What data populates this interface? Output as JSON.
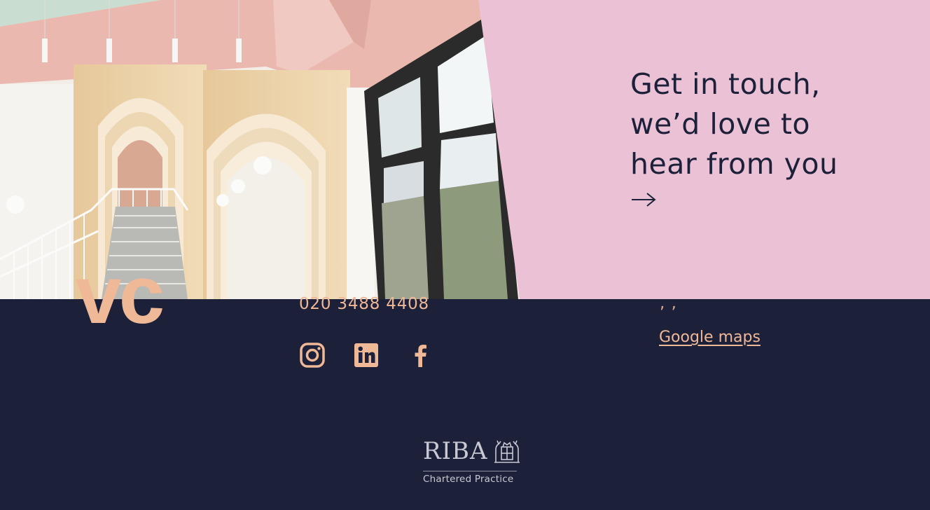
{
  "cta": {
    "lines": [
      "Get in touch,",
      "we’d love to",
      "hear from you"
    ],
    "arrow_icon": "arrow-right-icon"
  },
  "footer": {
    "big_letters": "vc",
    "phone": "020 3488 4408",
    "social": [
      {
        "icon": "instagram-icon"
      },
      {
        "icon": "linkedin-icon"
      },
      {
        "icon": "facebook-icon"
      }
    ],
    "address_fragment": ", ,",
    "maps_link": "Google maps",
    "riba": {
      "wordmark": "RIBA",
      "subtitle": "Chartered Practice",
      "crest_icon": "riba-crest-icon"
    }
  },
  "colors": {
    "navy": "#1d2039",
    "pink": "#ebc1d5",
    "peach": "#efb897",
    "riba_grey": "#c8c9d3"
  }
}
